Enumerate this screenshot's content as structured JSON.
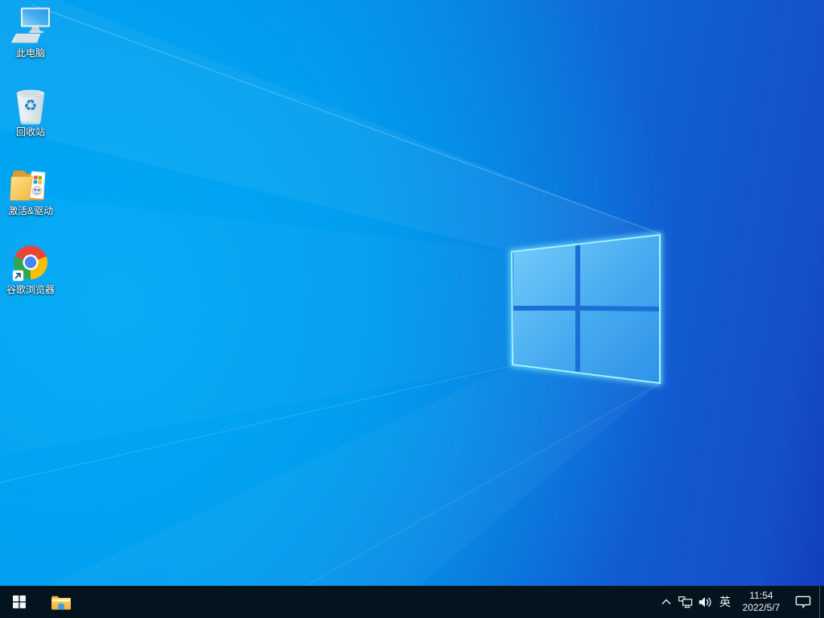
{
  "desktop": {
    "icons": [
      {
        "id": "this-pc",
        "label": "此电脑"
      },
      {
        "id": "recycle-bin",
        "label": "回收站"
      },
      {
        "id": "activation-drivers",
        "label": "激活&驱动"
      },
      {
        "id": "google-chrome",
        "label": "谷歌浏览器"
      }
    ]
  },
  "taskbar": {
    "tray": {
      "language": "英",
      "time": "11:54",
      "date": "2022/5/7"
    }
  },
  "icons": {
    "recycle_glyph": "♻"
  },
  "colors": {
    "taskbar_bg": "#04141f",
    "wallpaper_cyan": "#00a6f2",
    "wallpaper_deep_blue": "#1450ca",
    "logo_glow": "#8af0ff",
    "logo_pane_light": "#74ccf9",
    "logo_pane_dark": "#2b8fe8",
    "label_text": "#ffffff"
  }
}
